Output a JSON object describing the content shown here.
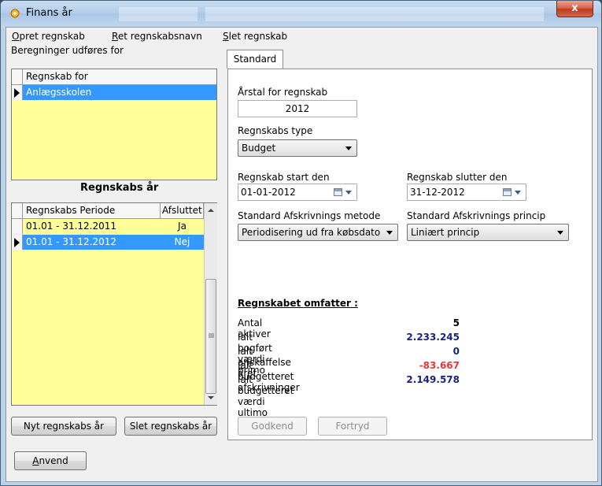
{
  "window": {
    "title": "Finans år",
    "close_label": "x"
  },
  "menu": {
    "items": [
      "Opret regnskab",
      "Ret regnskabsnavn",
      "Slet regnskab"
    ],
    "accelerators": [
      "O",
      "R",
      "S"
    ]
  },
  "left": {
    "group_label": "Beregninger udføres for",
    "regnskab_header": "Regnskab for",
    "regnskab_rows": [
      {
        "name": "Anlægsskolen",
        "selected": true
      }
    ],
    "years_title": "Regnskabs år",
    "years_columns": [
      "Regnskabs Periode",
      "Afsluttet"
    ],
    "years_rows": [
      {
        "period": "01.01 - 31.12.2011",
        "closed": "Ja",
        "selected": false
      },
      {
        "period": "01.01 - 31.12.2012",
        "closed": "Nej",
        "selected": true
      }
    ],
    "new_year_button": "Nyt regnskabs år",
    "delete_year_button": "Slet regnskabs år"
  },
  "tabs": {
    "active": "Standard"
  },
  "form": {
    "year_label": "Årstal for regnskab",
    "year_value": "2012",
    "type_label": "Regnskabs type",
    "type_value": "Budget",
    "start_label": "Regnskab start den",
    "start_value": "01-01-2012",
    "end_label": "Regnskab slutter den",
    "end_value": "31-12-2012",
    "depr_method_label": "Standard Afskrivnings metode",
    "depr_method_value": "Periodisering ud fra købsdato",
    "depr_principle_label": "Standard Afskrivnings princip",
    "depr_principle_value": "Liniært princip"
  },
  "summary": {
    "title": "Regnskabet omfatter :",
    "rows": [
      {
        "label": "Antal aktiver",
        "value": "5",
        "color": "#000000"
      },
      {
        "label": "Ialt bogført værdi primo",
        "value": "2.233.245",
        "color": "#1a237e"
      },
      {
        "label": "Ialt anskaffelse året",
        "value": "0",
        "color": "#1a237e"
      },
      {
        "label": "Ialt budgetteret afskrivninger",
        "value": "-83.667",
        "color": "#e53935"
      },
      {
        "label": "Ialt budgetteret værdi ultimo",
        "value": "2.149.578",
        "color": "#1a237e"
      }
    ]
  },
  "actions": {
    "approve": "Godkend",
    "cancel": "Fortryd",
    "apply": "Anvend",
    "apply_accelerator": "A"
  },
  "colors": {
    "grid_background": "#ffff99",
    "selection": "#3399ff"
  }
}
